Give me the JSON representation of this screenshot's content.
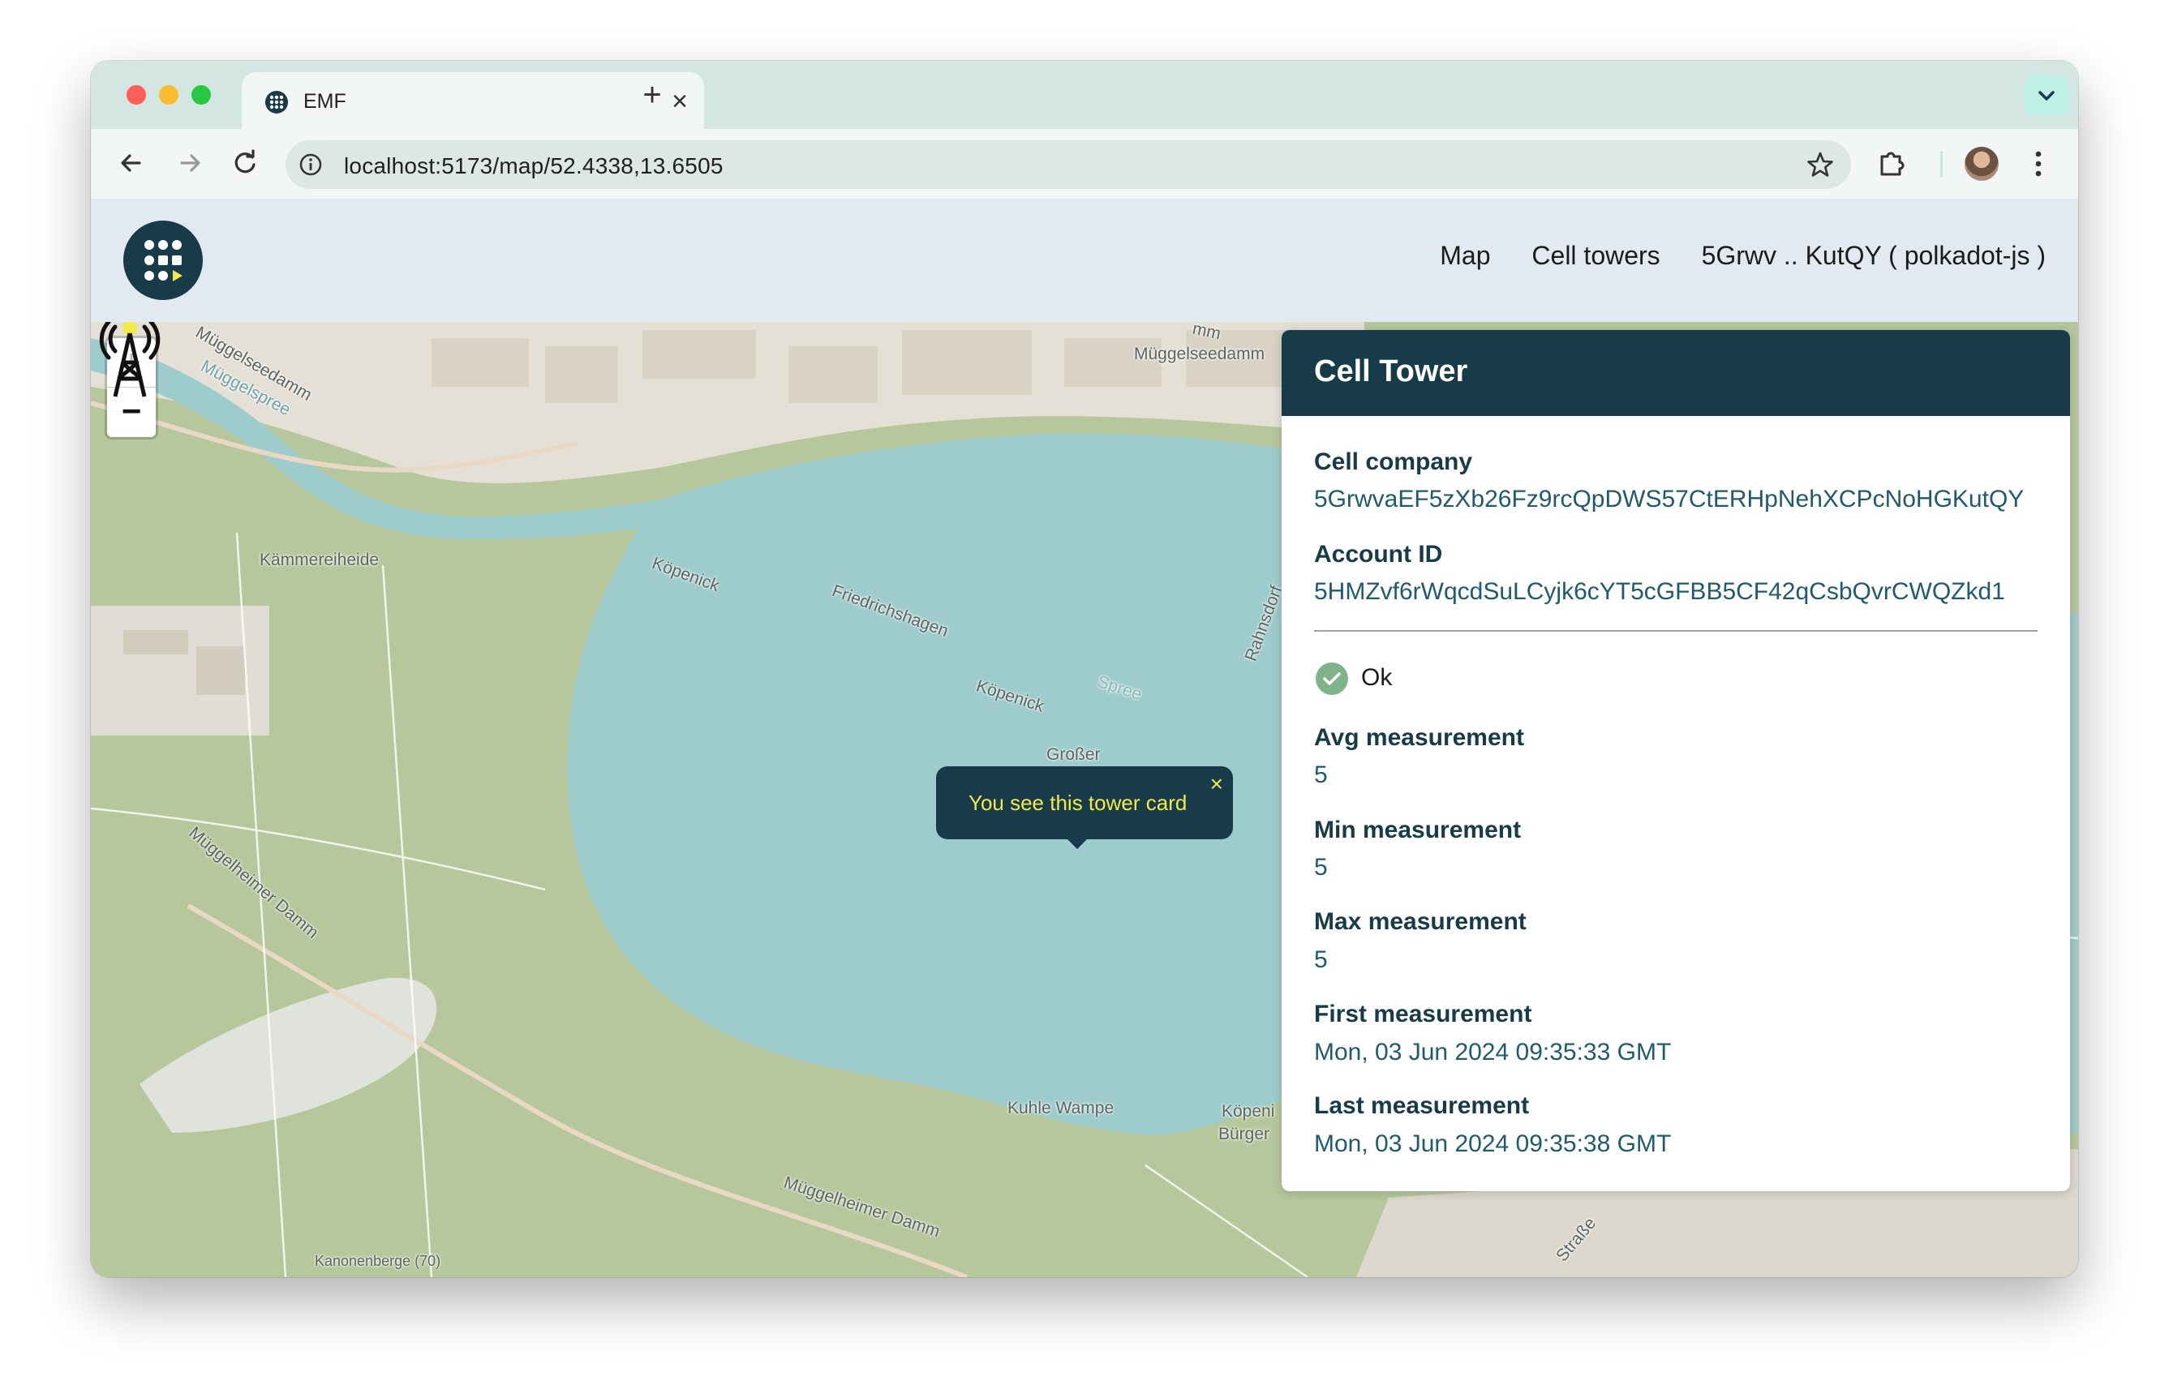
{
  "browser": {
    "tab_title": "EMF",
    "tab_close": "×",
    "new_tab": "+",
    "url": "localhost:5173/map/52.4338,13.6505"
  },
  "header": {
    "nav": {
      "map": "Map",
      "cell_towers": "Cell towers",
      "account": "5Grwv .. KutQY  ( polkadot-js )"
    }
  },
  "map": {
    "zoom_in": "+",
    "zoom_out": "−",
    "labels": {
      "muggelseedamm_left": "Müggelseedamm",
      "muggelspree": "Müggelspree",
      "muggelseedamm_right": "Müggelseedamm",
      "kammereiheide": "Kämmereiheide",
      "kopenick_1": "Köpenick",
      "friedrichshagen": "Friedrichshagen",
      "kopenick_2": "Köpenick",
      "spree": "Spree",
      "rahnsdorf": "Rahnsdorf",
      "grosser": "Großer",
      "muggelheimer_damm_1": "Müggelheimer Damm",
      "kuhle_wampe": "Kuhle Wampe",
      "kopeni": "Köpeni",
      "burger": "Bürger",
      "muggelheimer_damm_2": "Müggelheimer Damm",
      "kanonenberge": "Kanonenberge (70)",
      "strasse": "Straße",
      "mm": "mm"
    },
    "tooltip": {
      "text": "You see this tower card",
      "close": "×"
    }
  },
  "card": {
    "title": "Cell Tower",
    "cell_company_label": "Cell company",
    "cell_company_value": "5GrwvaEF5zXb26Fz9rcQpDWS57CtERHpNehXCPcNoHGKutQY",
    "account_id_label": "Account ID",
    "account_id_value": "5HMZvf6rWqcdSuLCyjk6cYT5cGFBB5CF42qCsbQvrCWQZkd1",
    "status": "Ok",
    "avg_label": "Avg measurement",
    "avg_value": "5",
    "min_label": "Min measurement",
    "min_value": "5",
    "max_label": "Max measurement",
    "max_value": "5",
    "first_label": "First measurement",
    "first_value": "Mon, 03 Jun 2024 09:35:33 GMT",
    "last_label": "Last measurement",
    "last_value": "Mon, 03 Jun 2024 09:35:38 GMT"
  },
  "colors": {
    "brand_dark": "#173b49",
    "tooltip_text": "#f4e94a",
    "status_ok": "#7fb38a",
    "water": "#9ecbcb",
    "forest": "#b6c79c"
  }
}
